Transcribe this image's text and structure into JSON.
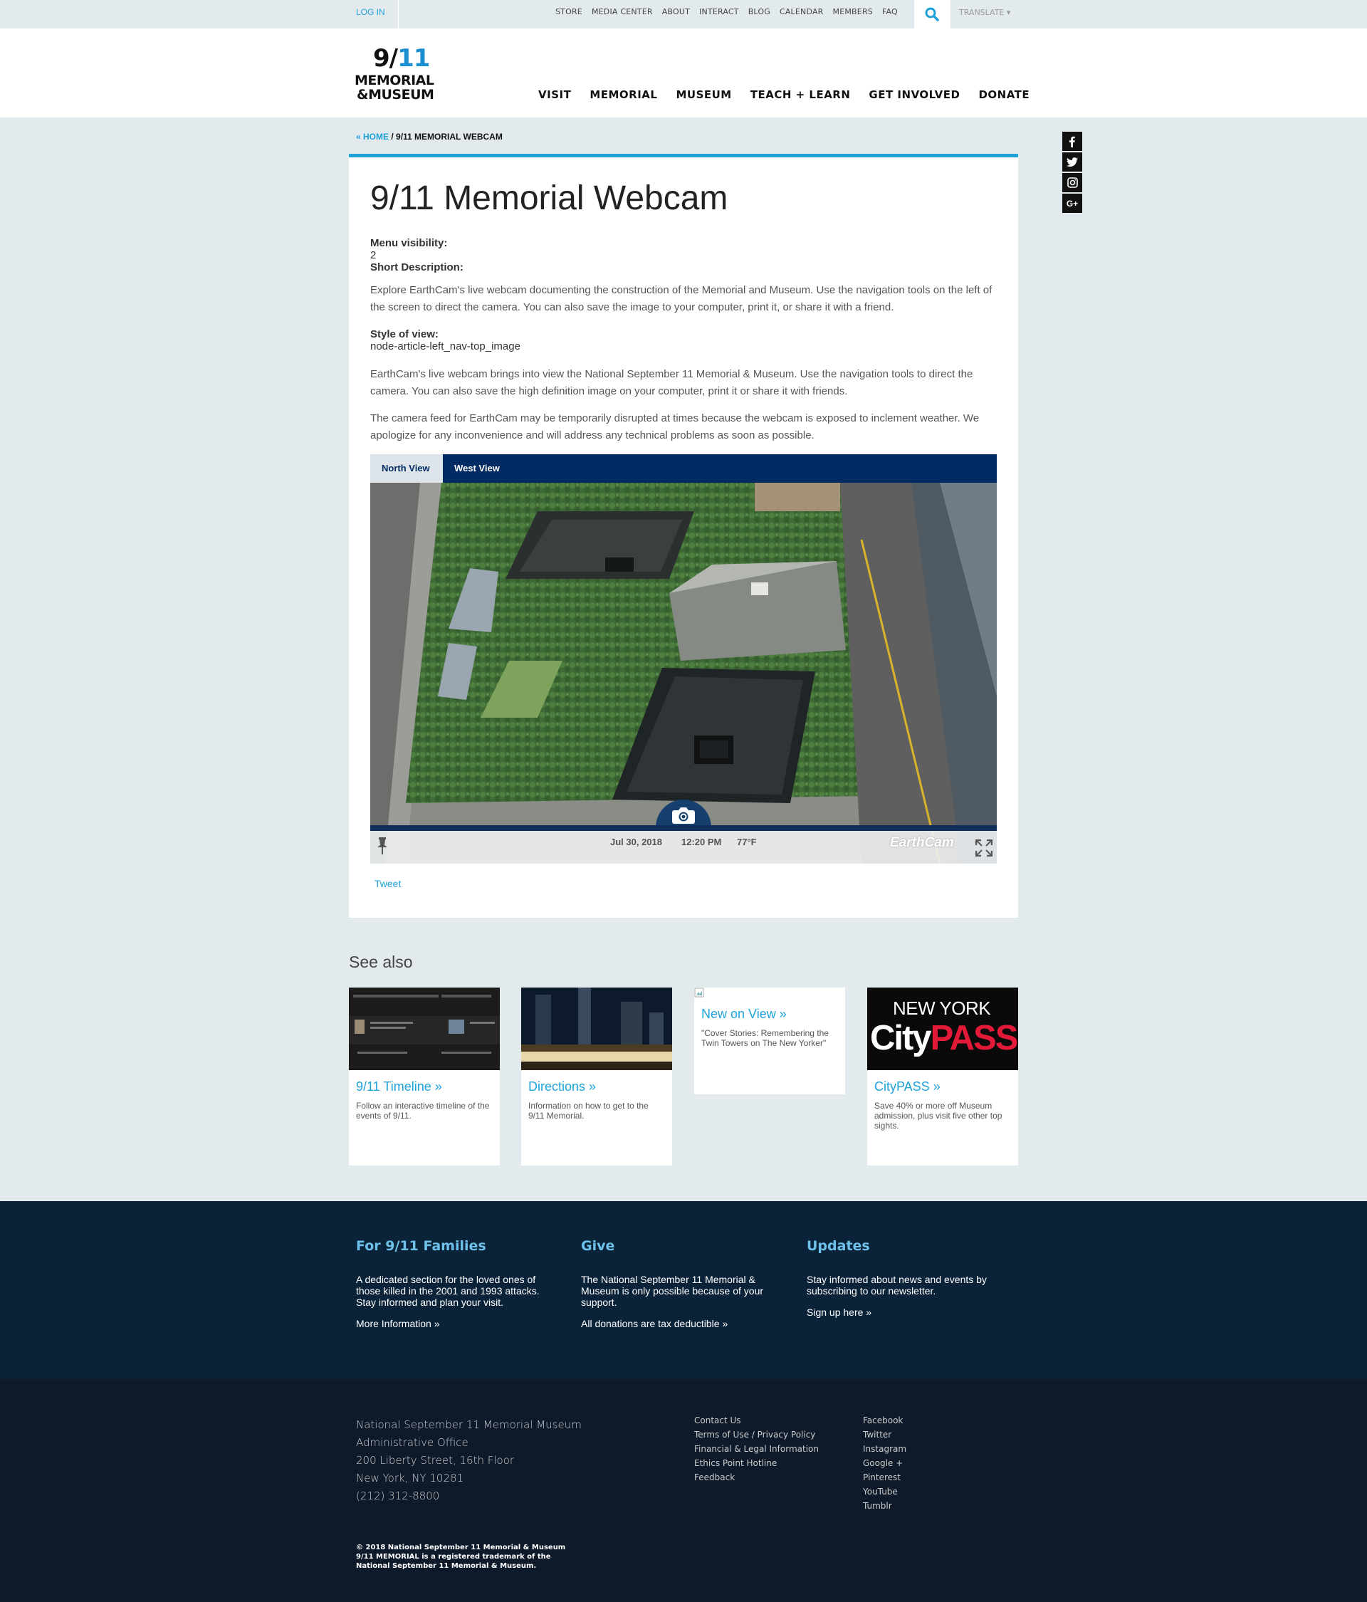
{
  "utility": {
    "login": "LOG IN",
    "links": [
      "STORE",
      "MEDIA CENTER",
      "ABOUT",
      "INTERACT",
      "BLOG",
      "CALENDAR",
      "MEMBERS",
      "FAQ"
    ],
    "translate": "TRANSLATE ▾",
    "search_icon": "search-icon"
  },
  "logo": {
    "line1a": "9/",
    "line1b": "11",
    "line2": "MEMORIAL",
    "line3": "&MUSEUM"
  },
  "nav": [
    "VISIT",
    "MEMORIAL",
    "MUSEUM",
    "TEACH + LEARN",
    "GET INVOLVED",
    "DONATE"
  ],
  "breadcrumb": {
    "home": "« HOME",
    "sep": " / ",
    "current": "9/11 MEMORIAL WEBCAM"
  },
  "social": [
    "f",
    "t",
    "ig",
    "G+"
  ],
  "article": {
    "title": "9/11 Memorial Webcam",
    "menu_visibility_label": "Menu visibility:",
    "menu_visibility_value": "2",
    "short_desc_label": "Short Description:",
    "short_desc": "Explore EarthCam's live webcam documenting the construction of the Memorial and Museum. Use the navigation tools on the left of the screen to direct the camera. You can also save the image to your computer, print it, or share it with a friend.",
    "style_label": "Style of view:",
    "style_value": "node-article-left_nav-top_image",
    "para1": "EarthCam's live webcam brings into view the National September 11 Memorial & Museum. Use the navigation tools to direct the camera. You can also save the high definition image on your computer, print it or share it with friends.",
    "para2": "The camera feed for EarthCam may be temporarily disrupted at times because the webcam is exposed to inclement weather. We apologize for any inconvenience and will address any technical problems as soon as possible.",
    "tabs": [
      "North View",
      "West View"
    ],
    "cam_date": "Jul 30, 2018",
    "cam_time": "12:20 PM",
    "cam_temp": "77°F",
    "cam_brand": "EarthCam",
    "tweet": "Tweet"
  },
  "see_also": {
    "title": "See also",
    "items": [
      {
        "title": "9/11 Timeline »",
        "desc": "Follow an interactive timeline of the events of 9/11."
      },
      {
        "title": "Directions »",
        "desc": "Information on how to get to the 9/11 Memorial."
      },
      {
        "title": "New on View »",
        "desc": "\"Cover Stories: Remembering the Twin Towers on The New Yorker\""
      },
      {
        "title": "CityPASS »",
        "desc": "Save 40% or more off Museum admission, plus visit five other top sights."
      }
    ],
    "citypass_line1": "NEW YORK",
    "citypass_line2a": "City",
    "citypass_line2b": "PASS"
  },
  "footer": {
    "cols": [
      {
        "title": "For 9/11 Families",
        "text": "A dedicated section for the loved ones of those killed in the 2001 and 1993 attacks. Stay informed and plan your visit.",
        "link": "More Information »"
      },
      {
        "title": "Give",
        "text": "The National September 11 Memorial & Museum is only possible because of your support.",
        "link": "All donations are tax deductible »"
      },
      {
        "title": "Updates",
        "text": "Stay informed about news and events by subscribing to our newsletter.",
        "link": "Sign up here »"
      }
    ],
    "address": [
      "National September 11 Memorial Museum",
      "Administrative Office",
      "200 Liberty Street, 16th Floor",
      "New York, NY 10281",
      "(212) 312-8800"
    ],
    "links1": [
      "Contact Us",
      "Terms of Use / Privacy Policy",
      "Financial & Legal Information",
      "Ethics Point Hotline",
      "Feedback"
    ],
    "links2": [
      "Facebook",
      "Twitter",
      "Instagram",
      "Google +",
      "Pinterest",
      "YouTube",
      "Tumblr"
    ],
    "copyright": [
      "© 2018 National September 11 Memorial & Museum",
      "9/11 MEMORIAL is a registered trademark of the",
      "National September 11 Memorial & Museum."
    ]
  }
}
